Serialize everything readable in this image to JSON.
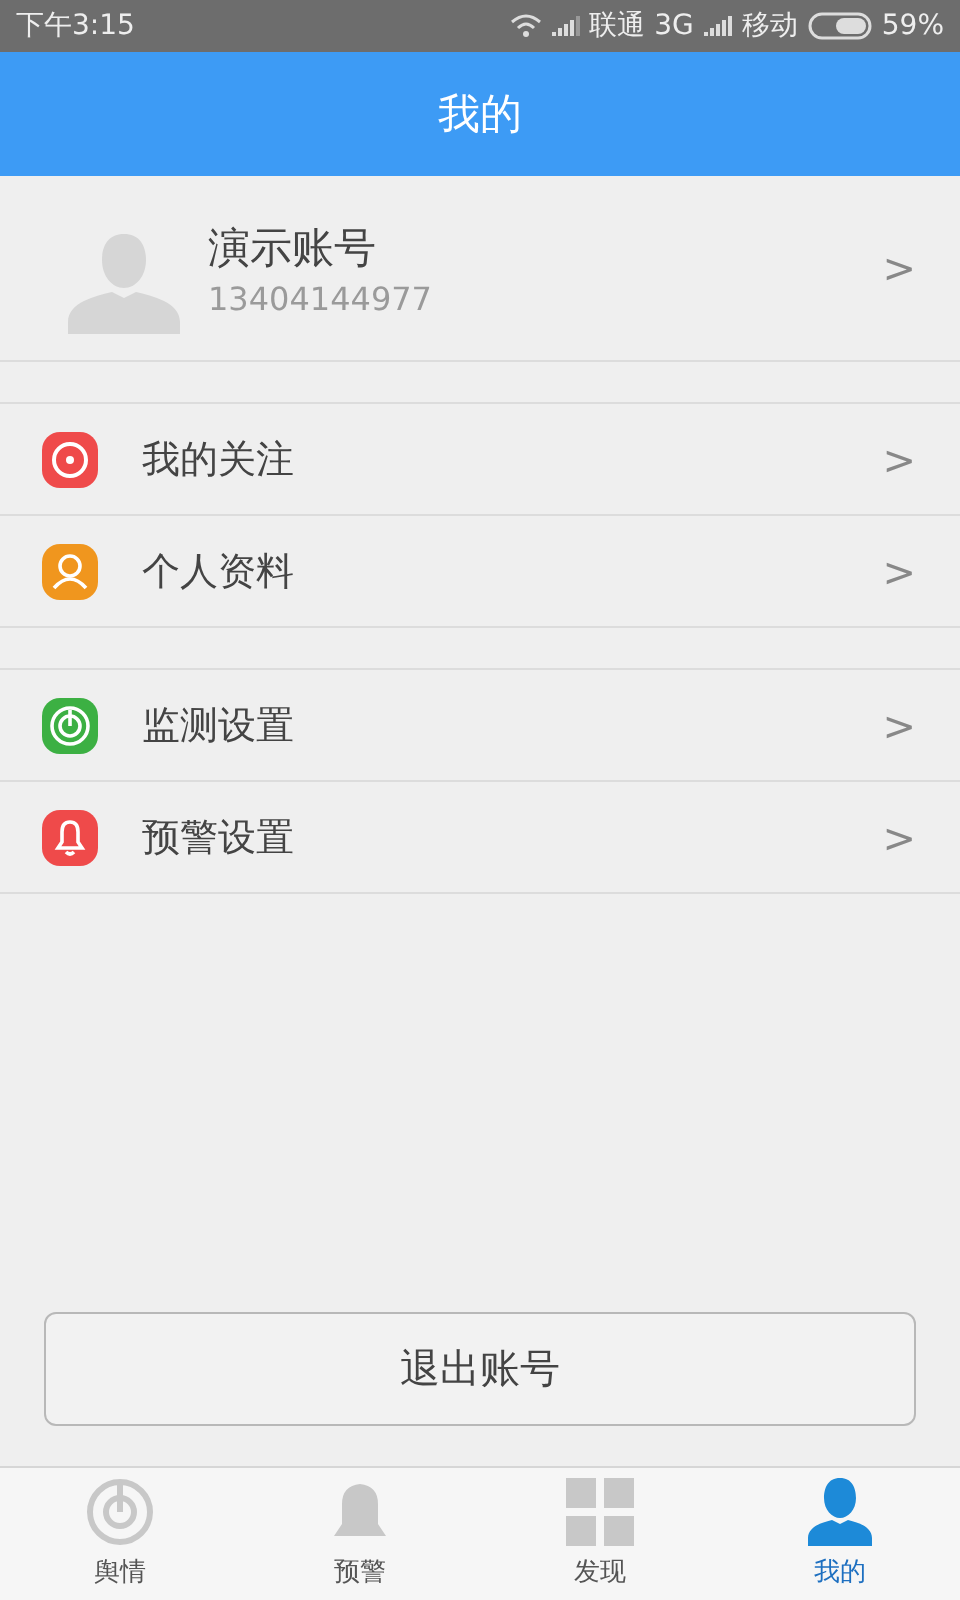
{
  "status_bar": {
    "time": "下午3:15",
    "carrier_1": "联通 3G",
    "carrier_2": "移动",
    "battery": "59%"
  },
  "header": {
    "title": "我的"
  },
  "profile": {
    "name": "演示账号",
    "phone": "13404144977",
    "chevron": ">"
  },
  "sections": [
    {
      "items": [
        {
          "kind": "target",
          "color": "#ef4a4a",
          "label": "我的关注",
          "chevron": ">"
        },
        {
          "kind": "person",
          "color": "#f0961e",
          "label": "个人资料",
          "chevron": ">"
        }
      ]
    },
    {
      "items": [
        {
          "kind": "power",
          "color": "#3cb043",
          "label": "监测设置",
          "chevron": ">"
        },
        {
          "kind": "bell",
          "color": "#ef4a4a",
          "label": "预警设置",
          "chevron": ">"
        }
      ]
    }
  ],
  "logout_button": "退出账号",
  "tabs": [
    {
      "kind": "radar",
      "label": "舆情",
      "selected": false
    },
    {
      "kind": "bell",
      "label": "预警",
      "selected": false
    },
    {
      "kind": "grid",
      "label": "发现",
      "selected": false
    },
    {
      "kind": "person",
      "label": "我的",
      "selected": true
    }
  ]
}
